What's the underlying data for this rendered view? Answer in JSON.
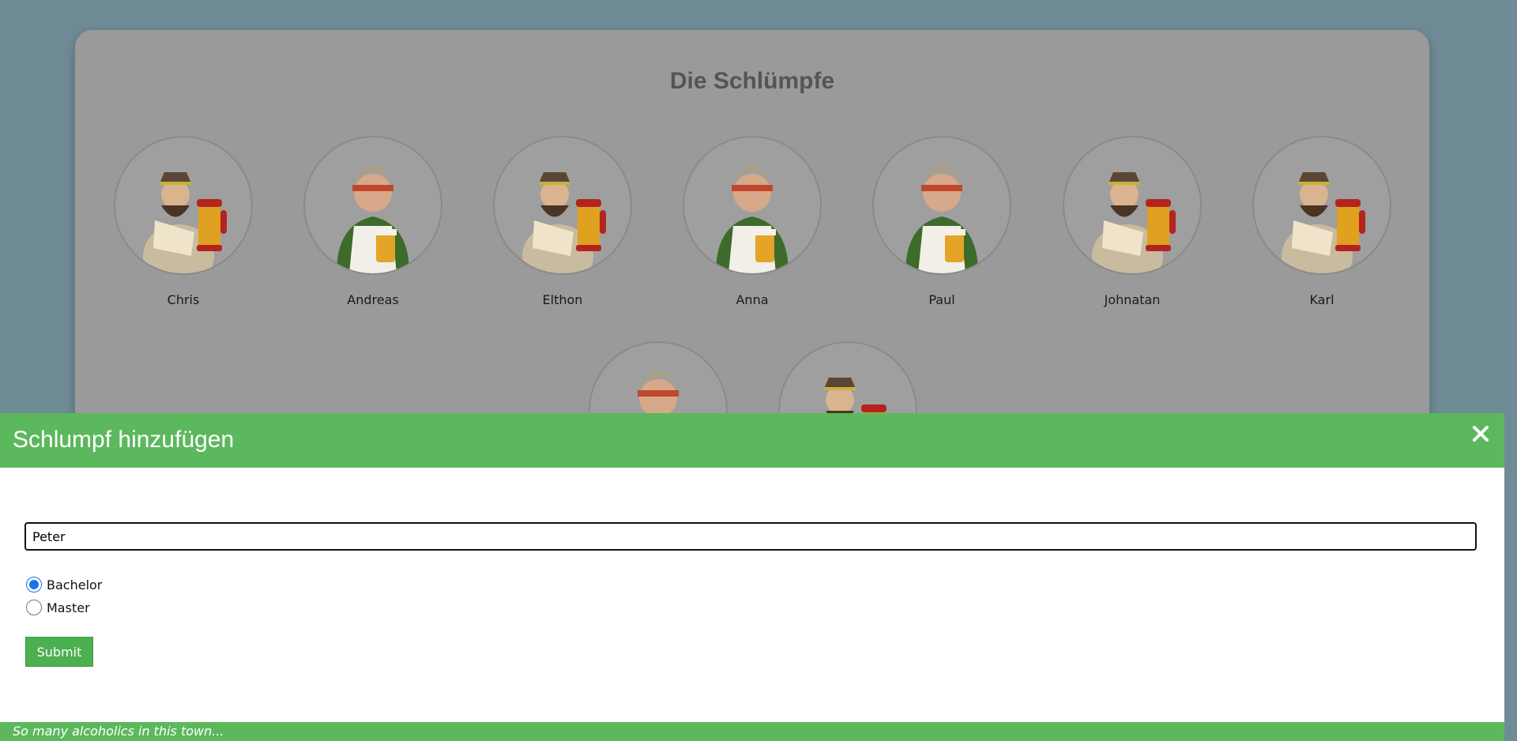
{
  "page": {
    "title": "Die Schlümpfe"
  },
  "people": [
    {
      "name": "Chris",
      "avatar": "beer-man-icon"
    },
    {
      "name": "Andreas",
      "avatar": "innkeeper-icon"
    },
    {
      "name": "Elthon",
      "avatar": "beer-man-icon"
    },
    {
      "name": "Anna",
      "avatar": "innkeeper-icon"
    },
    {
      "name": "Paul",
      "avatar": "innkeeper-icon"
    },
    {
      "name": "Johnatan",
      "avatar": "beer-man-icon"
    },
    {
      "name": "Karl",
      "avatar": "beer-man-icon"
    },
    {
      "name": "",
      "avatar": "innkeeper-icon"
    },
    {
      "name": "",
      "avatar": "beer-man-icon"
    }
  ],
  "modal": {
    "title": "Schlumpf hinzufügen",
    "name_value": "Peter",
    "options": [
      {
        "label": "Bachelor",
        "checked": true
      },
      {
        "label": "Master",
        "checked": false
      }
    ],
    "submit_label": "Submit",
    "footer_text": "So many alcoholics in this town..."
  },
  "colors": {
    "modal_green": "#5cb85c",
    "submit_green": "#4caf50",
    "backdrop": "#6f8c96",
    "card": "#9a9a9a"
  }
}
